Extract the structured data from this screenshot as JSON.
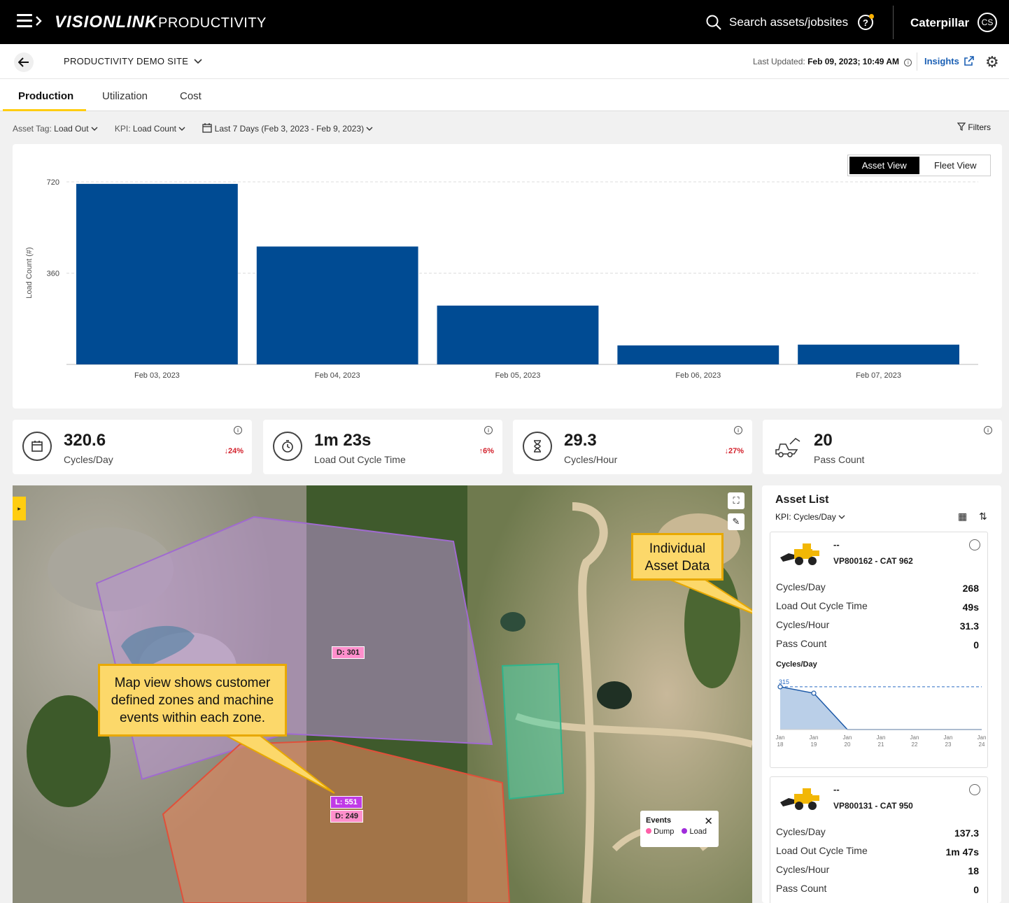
{
  "app": {
    "brand": "VISIONLINK",
    "product": "PRODUCTIVITY",
    "search_placeholder": "Search assets/jobsites",
    "org": "Caterpillar",
    "user_initials": "CS"
  },
  "site": {
    "name": "PRODUCTIVITY DEMO SITE",
    "last_updated_label": "Last Updated:",
    "last_updated_value": "Feb 09, 2023; 10:49 AM",
    "insights_label": "Insights"
  },
  "tabs": [
    {
      "label": "Production"
    },
    {
      "label": "Utilization"
    },
    {
      "label": "Cost"
    }
  ],
  "filters": {
    "asset_tag_label": "Asset Tag:",
    "asset_tag_value": "Load Out",
    "kpi_label": "KPI:",
    "kpi_value": "Load Count",
    "date_range": "Last 7 Days (Feb 3, 2023 - Feb 9, 2023)",
    "filters_label": "Filters"
  },
  "view_toggle": {
    "asset": "Asset View",
    "fleet": "Fleet View"
  },
  "chart_data": {
    "type": "bar",
    "categories": [
      "Feb 03, 2023",
      "Feb 04, 2023",
      "Feb 05, 2023",
      "Feb 06, 2023",
      "Feb 07, 2023"
    ],
    "values": [
      712,
      465,
      232,
      75,
      78
    ],
    "ylabel": "Load Count (#)",
    "ylim": [
      0,
      720
    ],
    "yticks": [
      360,
      720
    ],
    "color": "#004b93",
    "grid": true
  },
  "kpis": [
    {
      "value": "320.6",
      "label": "Cycles/Day",
      "change": "↓24%"
    },
    {
      "value": "1m 23s",
      "label": "Load Out Cycle Time",
      "change": "↑6%"
    },
    {
      "value": "29.3",
      "label": "Cycles/Hour",
      "change": "↓27%"
    },
    {
      "value": "20",
      "label": "Pass Count",
      "change": ""
    }
  ],
  "map": {
    "tags": {
      "d301": "D: 301",
      "l551": "L: 551",
      "d249": "D: 249"
    },
    "legend": {
      "title": "Events",
      "dump": "Dump",
      "load": "Load"
    },
    "callout_zones": "Map view shows customer defined zones and machine events within each zone.",
    "callout_asset": "Individual Asset Data"
  },
  "asset_list": {
    "title": "Asset List",
    "kpi_label": "KPI:",
    "kpi_value": "Cycles/Day",
    "assets": [
      {
        "dash": "--",
        "name": "VP800162 - CAT 962",
        "metrics": [
          {
            "label": "Cycles/Day",
            "value": "268"
          },
          {
            "label": "Load Out Cycle Time",
            "value": "49s"
          },
          {
            "label": "Cycles/Hour",
            "value": "31.3"
          },
          {
            "label": "Pass Count",
            "value": "0"
          }
        ],
        "spark": {
          "title": "Cycles/Day",
          "target": "315",
          "x": [
            "Jan 18",
            "Jan 19",
            "Jan 20",
            "Jan 21",
            "Jan 22",
            "Jan 23",
            "Jan 24"
          ],
          "values": [
            315,
            268,
            0,
            0,
            0,
            0,
            0
          ]
        }
      },
      {
        "dash": "--",
        "name": "VP800131 - CAT 950",
        "metrics": [
          {
            "label": "Cycles/Day",
            "value": "137.3"
          },
          {
            "label": "Load Out Cycle Time",
            "value": "1m 47s"
          },
          {
            "label": "Cycles/Hour",
            "value": "18"
          },
          {
            "label": "Pass Count",
            "value": "0"
          }
        ]
      }
    ]
  }
}
